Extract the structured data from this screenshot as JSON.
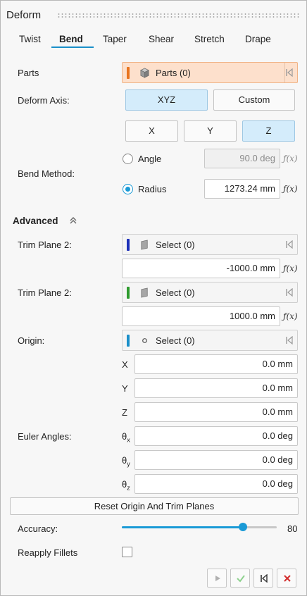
{
  "header": {
    "title": "Deform"
  },
  "tabs": [
    {
      "label": "Twist",
      "active": false
    },
    {
      "label": "Bend",
      "active": true
    },
    {
      "label": "Taper",
      "active": false
    },
    {
      "label": "Shear",
      "active": false
    },
    {
      "label": "Stretch",
      "active": false
    },
    {
      "label": "Drape",
      "active": false
    }
  ],
  "parts": {
    "label": "Parts",
    "selector_text": "Parts (0)",
    "color": "#e8741e"
  },
  "deform_axis": {
    "label": "Deform Axis:",
    "modes": [
      "XYZ",
      "Custom"
    ],
    "selected_mode": "XYZ",
    "axes": [
      "X",
      "Y",
      "Z"
    ],
    "selected_axis": "Z"
  },
  "bend_method": {
    "label": "Bend Method:",
    "angle_label": "Angle",
    "angle_value": "90.0 deg",
    "radius_label": "Radius",
    "radius_value": "1273.24 mm",
    "selected": "Radius",
    "fx_symbol": "ƒ(x)"
  },
  "advanced": {
    "label": "Advanced",
    "icon": "double-chevron-up-icon"
  },
  "trim_plane_1": {
    "label": "Trim Plane 2:",
    "selector_text": "Select (0)",
    "color": "#1c2fb8",
    "value": "-1000.0 mm"
  },
  "trim_plane_2": {
    "label": "Trim Plane 2:",
    "selector_text": "Select (0)",
    "color": "#2e9b2e",
    "value": "1000.0 mm"
  },
  "origin": {
    "label": "Origin:",
    "selector_text": "Select (0)",
    "color": "#1a8fc9",
    "x_label": "X",
    "x_value": "0.0 mm",
    "y_label": "Y",
    "y_value": "0.0 mm",
    "z_label": "Z",
    "z_value": "0.0 mm"
  },
  "euler": {
    "label": "Euler Angles:",
    "tx_label": "θx",
    "tx_value": "0.0 deg",
    "ty_label": "θy",
    "ty_value": "0.0 deg",
    "tz_label": "θz",
    "tz_value": "0.0 deg"
  },
  "reset_button": {
    "label": "Reset Origin And Trim Planes"
  },
  "accuracy": {
    "label": "Accuracy:",
    "value": "80",
    "level": 0.78
  },
  "reapply_fillets": {
    "label": "Reapply Fillets",
    "checked": false
  },
  "footer": {
    "buttons": [
      "play-icon",
      "check-icon",
      "reset-icon",
      "close-icon"
    ]
  }
}
